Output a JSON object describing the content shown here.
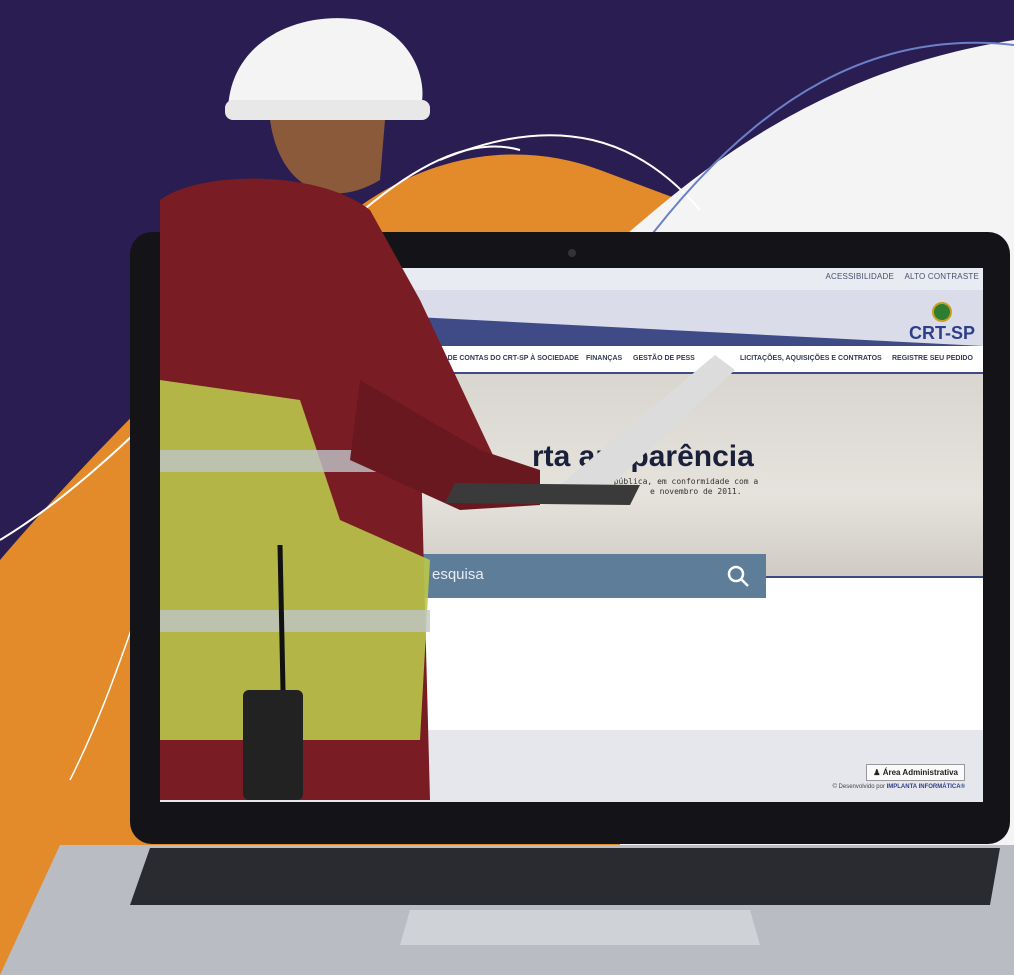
{
  "screen": {
    "top_links": [
      "ACESSIBILIDADE",
      "ALTO CONTRASTE"
    ],
    "title_fragment": "ncia",
    "logo_text": "CRT-SP",
    "nav_items": [
      "PRESTAÇÕES DE CONTAS DO CRT-SP À SOCIEDADE",
      "FINANÇAS",
      "GESTÃO DE PESS",
      "LICITAÇÕES, AQUISIÇÕES E CONTRATOS",
      "REGISTRE SEU PEDIDO"
    ],
    "hero_heading": "rta     ansparência",
    "hero_sub_1": "tração pública, em conformidade com a",
    "hero_sub_2": "e novembro de 2011.",
    "search_placeholder": "esquisa",
    "admin_button": "Área Administrativa",
    "credit_prefix": "© Desenvolvido por",
    "credit_company": "IMPLANTA INFORMÁTICA®"
  },
  "colors": {
    "background": "#2a1d52",
    "orange": "#e38a2a",
    "header_blue": "#3f4b87",
    "search_blue": "#5e7d98"
  }
}
